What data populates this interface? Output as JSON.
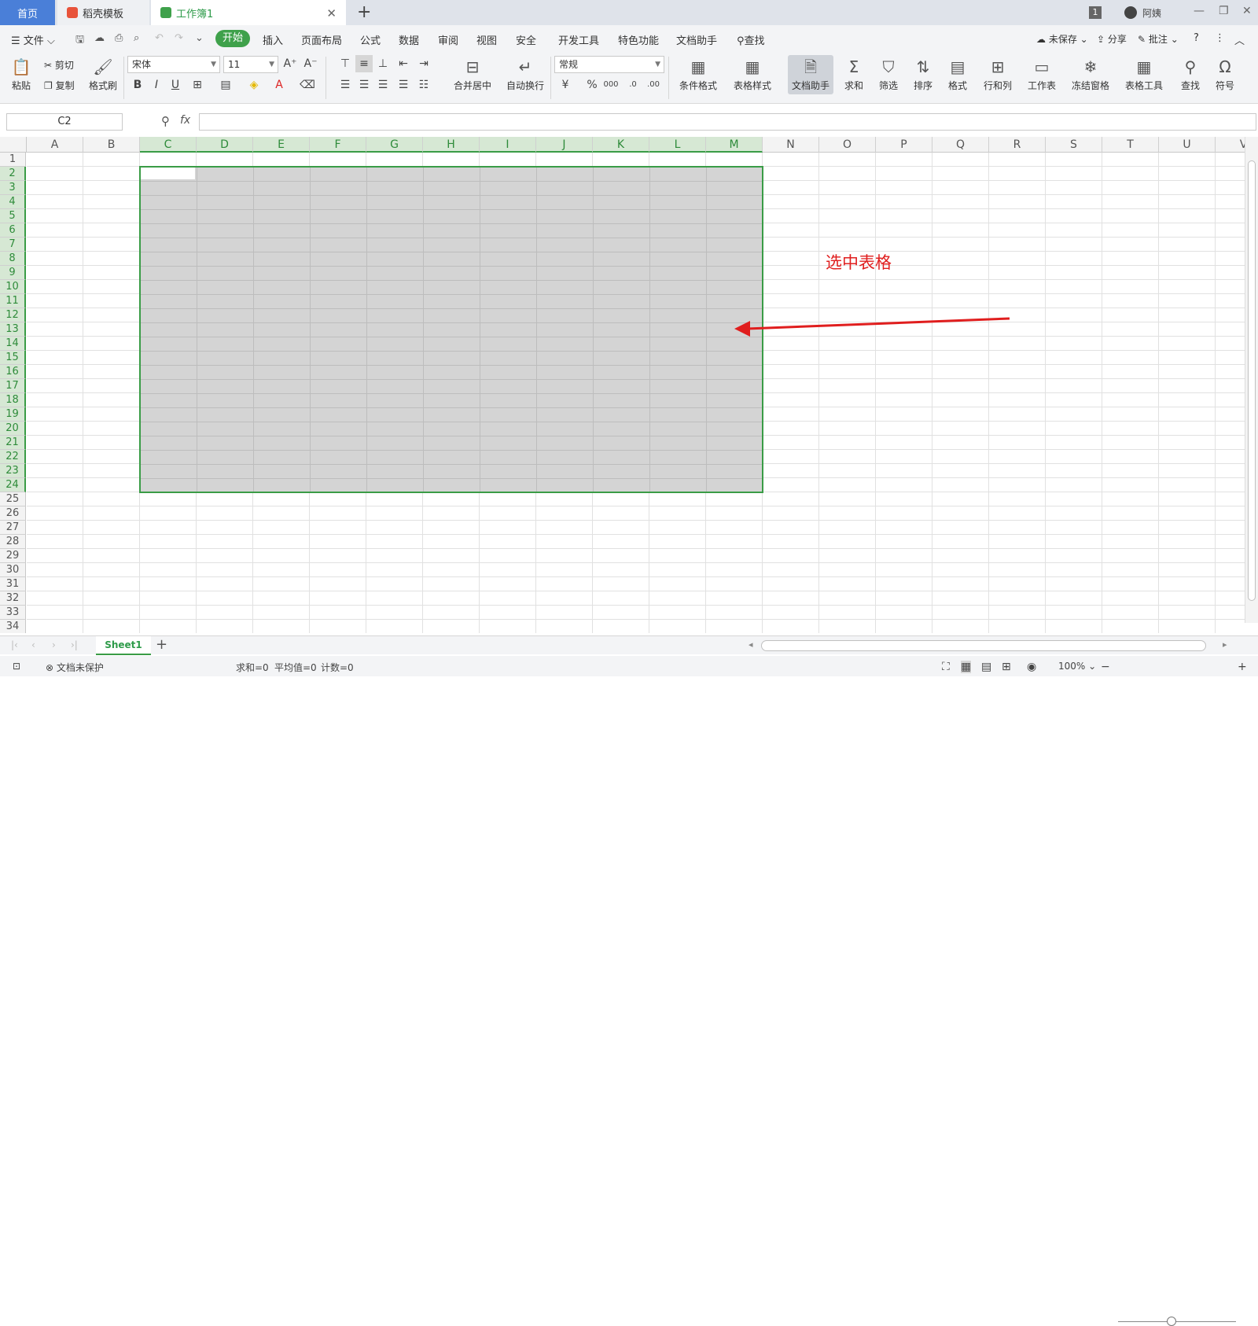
{
  "tabs": {
    "home": "首页",
    "template": "稻壳模板",
    "workbook": "工作簿1"
  },
  "titlebar": {
    "badge": "1",
    "user": "阿姨"
  },
  "menu": {
    "file": "文件",
    "items": [
      "开始",
      "插入",
      "页面布局",
      "公式",
      "数据",
      "审阅",
      "视图",
      "安全",
      "开发工具",
      "特色功能",
      "文档助手"
    ],
    "search": "查找",
    "unsaved": "未保存",
    "share": "分享",
    "comment": "批注"
  },
  "ribbon": {
    "paste": "粘贴",
    "cut": "剪切",
    "copy": "复制",
    "format_painter": "格式刷",
    "font_name": "宋体",
    "font_size": "11",
    "number_format": "常规",
    "merge_center": "合并居中",
    "wrap": "自动换行",
    "cond_format": "条件格式",
    "table_style": "表格样式",
    "doc_assist": "文档助手",
    "sum": "求和",
    "filter": "筛选",
    "sort": "排序",
    "format": "格式",
    "rows_cols": "行和列",
    "worksheet": "工作表",
    "freeze": "冻结窗格",
    "table_tools": "表格工具",
    "find": "查找",
    "symbol": "符号"
  },
  "formula": {
    "name_box": "C2",
    "fx": "fx",
    "value": ""
  },
  "sheet": {
    "columns": [
      "A",
      "B",
      "C",
      "D",
      "E",
      "F",
      "G",
      "H",
      "I",
      "J",
      "K",
      "L",
      "M",
      "N",
      "O",
      "P",
      "Q",
      "R",
      "S",
      "T",
      "U",
      "V"
    ],
    "rows": [
      "1",
      "2",
      "3",
      "4",
      "5",
      "6",
      "7",
      "8",
      "9",
      "10",
      "11",
      "12",
      "13",
      "14",
      "15",
      "16",
      "17",
      "18",
      "19",
      "20",
      "21",
      "22",
      "23",
      "24",
      "25",
      "26",
      "27",
      "28",
      "29",
      "30",
      "31",
      "32",
      "33",
      "34"
    ],
    "annotation": "选中表格",
    "tab": "Sheet1"
  },
  "status": {
    "protect": "文档未保护",
    "sum": "求和=0",
    "avg": "平均值=0",
    "count": "计数=0",
    "zoom": "100%"
  },
  "colors": {
    "accent": "#3fa14b",
    "selection": "#d4d4d4",
    "annotation": "#e01e1e",
    "home_tab": "#4a7fd8"
  }
}
